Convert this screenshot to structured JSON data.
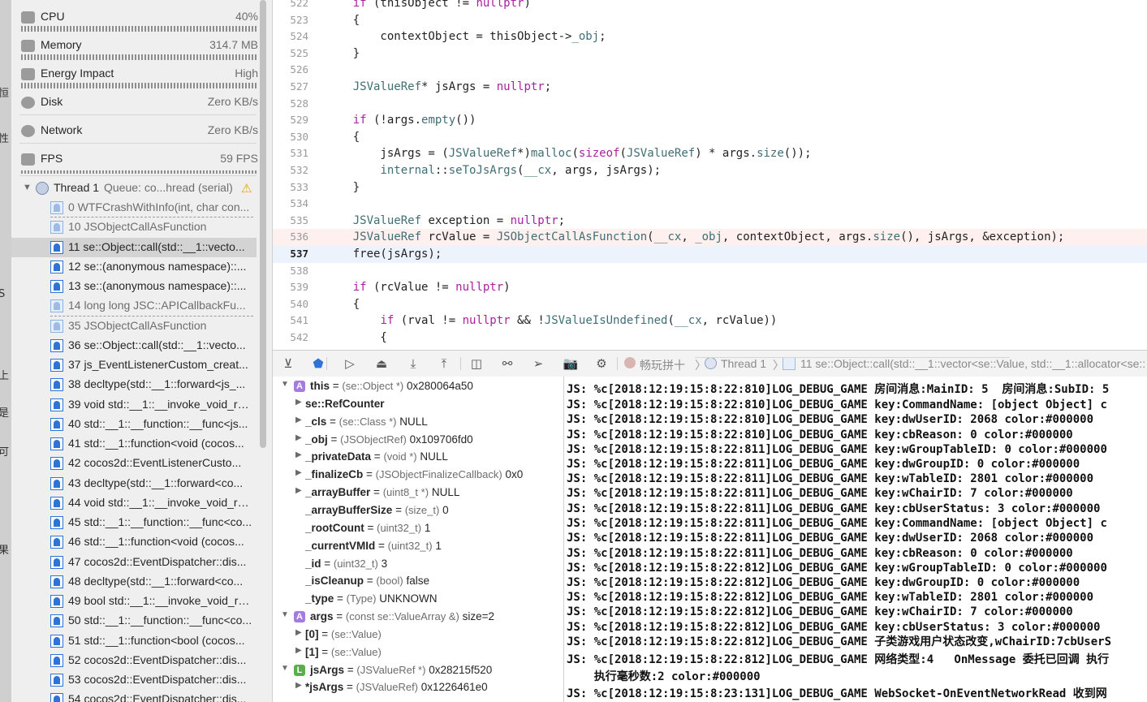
{
  "left_strip": [
    "恒",
    "性",
    "S",
    "上",
    "是",
    "可",
    "果"
  ],
  "gauges": [
    {
      "name": "CPU",
      "value": "40%",
      "icon": "cpu-icon"
    },
    {
      "name": "Memory",
      "value": "314.7 MB",
      "icon": "memory-icon"
    },
    {
      "name": "Energy Impact",
      "value": "High",
      "icon": "battery-icon"
    },
    {
      "name": "Disk",
      "value": "Zero KB/s",
      "icon": "disk-icon"
    },
    {
      "name": "Network",
      "value": "Zero KB/s",
      "icon": "network-icon"
    },
    {
      "name": "FPS",
      "value": "59 FPS",
      "icon": "fps-icon"
    }
  ],
  "thread": {
    "label": "Thread 1",
    "queue": "Queue: co...hread (serial)",
    "warning_icon": "warning-icon"
  },
  "frames": [
    {
      "text": "0 WTFCrashWithInfo(int, char con...",
      "system": true
    },
    {
      "text": "10 JSObjectCallAsFunction",
      "system": true
    },
    {
      "text": "11 se::Object::call(std::__1::vecto...",
      "system": false,
      "selected": true
    },
    {
      "text": "12 se::(anonymous namespace)::...",
      "system": false
    },
    {
      "text": "13 se::(anonymous namespace)::...",
      "system": false
    },
    {
      "text": "14 long long JSC::APICallbackFu...",
      "system": true
    },
    {
      "text": "35 JSObjectCallAsFunction",
      "system": true
    },
    {
      "text": "36 se::Object::call(std::__1::vecto...",
      "system": false
    },
    {
      "text": "37 js_EventListenerCustom_creat...",
      "system": false
    },
    {
      "text": "38 decltype(std::__1::forward<js_...",
      "system": false
    },
    {
      "text": "39 void std::__1::__invoke_void_re...",
      "system": false
    },
    {
      "text": "40 std::__1::__function::__func<js...",
      "system": false
    },
    {
      "text": "41 std::__1::function<void (cocos...",
      "system": false
    },
    {
      "text": "42 cocos2d::EventListenerCusto...",
      "system": false
    },
    {
      "text": "43 decltype(std::__1::forward<co...",
      "system": false
    },
    {
      "text": "44 void std::__1::__invoke_void_re...",
      "system": false
    },
    {
      "text": "45 std::__1::__function::__func<co...",
      "system": false
    },
    {
      "text": "46 std::__1::function<void (cocos...",
      "system": false
    },
    {
      "text": "47 cocos2d::EventDispatcher::dis...",
      "system": false
    },
    {
      "text": "48 decltype(std::__1::forward<co...",
      "system": false
    },
    {
      "text": "49 bool std::__1::__invoke_void_re...",
      "system": false
    },
    {
      "text": "50 std::__1::__function::__func<co...",
      "system": false
    },
    {
      "text": "51 std::__1::function<bool (cocos...",
      "system": false
    },
    {
      "text": "52 cocos2d::EventDispatcher::dis...",
      "system": false
    },
    {
      "text": "53 cocos2d::EventDispatcher::dis...",
      "system": false
    },
    {
      "text": "54 cocos2d::EventDispatcher::dis...",
      "system": false
    }
  ],
  "editor": {
    "current_line": 537,
    "highlight_line": 536,
    "lines": [
      {
        "no": "522",
        "code": "    if (thisObject != nullptr)"
      },
      {
        "no": "523",
        "code": "    {"
      },
      {
        "no": "524",
        "code": "        contextObject = thisObject->_obj;"
      },
      {
        "no": "525",
        "code": "    }"
      },
      {
        "no": "526",
        "code": ""
      },
      {
        "no": "527",
        "code": "    JSValueRef* jsArgs = nullptr;"
      },
      {
        "no": "528",
        "code": ""
      },
      {
        "no": "529",
        "code": "    if (!args.empty())"
      },
      {
        "no": "530",
        "code": "    {"
      },
      {
        "no": "531",
        "code": "        jsArgs = (JSValueRef*)malloc(sizeof(JSValueRef) * args.size());"
      },
      {
        "no": "532",
        "code": "        internal::seToJsArgs(__cx, args, jsArgs);"
      },
      {
        "no": "533",
        "code": "    }"
      },
      {
        "no": "534",
        "code": ""
      },
      {
        "no": "535",
        "code": "    JSValueRef exception = nullptr;"
      },
      {
        "no": "536",
        "code": "    JSValueRef rcValue = JSObjectCallAsFunction(__cx, _obj, contextObject, args.size(), jsArgs, &exception);"
      },
      {
        "no": "537",
        "code": "    free(jsArgs);"
      },
      {
        "no": "538",
        "code": ""
      },
      {
        "no": "539",
        "code": "    if (rcValue != nullptr)"
      },
      {
        "no": "540",
        "code": "    {"
      },
      {
        "no": "541",
        "code": "        if (rval != nullptr && !JSValueIsUndefined(__cx, rcValue))"
      },
      {
        "no": "542",
        "code": "        {"
      }
    ]
  },
  "debugbar": {
    "buttons": [
      {
        "name": "hide-debug-area-button",
        "icon": "panel-toggle-icon",
        "glyph": "⊻"
      },
      {
        "name": "breakpoints-toggle-button",
        "icon": "breakpoint-icon",
        "glyph": "⬟"
      },
      {
        "name": "continue-button",
        "icon": "continue-icon",
        "glyph": "▷"
      },
      {
        "name": "step-over-button",
        "icon": "step-over-icon",
        "glyph": "⏏"
      },
      {
        "name": "step-into-button",
        "icon": "step-into-icon",
        "glyph": "⤓"
      },
      {
        "name": "step-out-button",
        "icon": "step-out-icon",
        "glyph": "⤒"
      },
      {
        "name": "view-hierarchy-button",
        "icon": "view-hierarchy-icon",
        "glyph": "◫"
      },
      {
        "name": "memory-graph-button",
        "icon": "memory-graph-icon",
        "glyph": "⚯"
      },
      {
        "name": "simulate-location-button",
        "icon": "location-arrow-icon",
        "glyph": "➢"
      },
      {
        "name": "camera-button",
        "icon": "camera-icon",
        "glyph": "📷"
      },
      {
        "name": "environment-overrides-button",
        "icon": "gear-icon",
        "glyph": "⚙"
      }
    ],
    "breadcrumbs": [
      "畅玩拼十",
      "Thread 1",
      "11 se::Object::call(std::__1::vector<se::Value, std::__1::allocator<se::"
    ],
    "separator": "〉"
  },
  "variables": [
    {
      "indent": 0,
      "expand": "open",
      "badge": "A",
      "name": "this",
      "type": "(se::Object *)",
      "value": "0x280064a50"
    },
    {
      "indent": 1,
      "expand": "closed",
      "badge": "",
      "name": "se::RefCounter",
      "type": "",
      "value": ""
    },
    {
      "indent": 1,
      "expand": "closed",
      "badge": "",
      "name": "_cls",
      "type": "(se::Class *)",
      "value": "NULL"
    },
    {
      "indent": 1,
      "expand": "closed",
      "badge": "",
      "name": "_obj",
      "type": "(JSObjectRef)",
      "value": "0x109706fd0"
    },
    {
      "indent": 1,
      "expand": "closed",
      "badge": "",
      "name": "_privateData",
      "type": "(void *)",
      "value": "NULL"
    },
    {
      "indent": 1,
      "expand": "closed",
      "badge": "",
      "name": "_finalizeCb",
      "type": "(JSObjectFinalizeCallback)",
      "value": "0x0"
    },
    {
      "indent": 1,
      "expand": "closed",
      "badge": "",
      "name": "_arrayBuffer",
      "type": "(uint8_t *)",
      "value": "NULL"
    },
    {
      "indent": 1,
      "expand": "none",
      "badge": "",
      "name": "_arrayBufferSize",
      "type": "(size_t)",
      "value": "0"
    },
    {
      "indent": 1,
      "expand": "none",
      "badge": "",
      "name": "_rootCount",
      "type": "(uint32_t)",
      "value": "1"
    },
    {
      "indent": 1,
      "expand": "none",
      "badge": "",
      "name": "_currentVMId",
      "type": "(uint32_t)",
      "value": "1"
    },
    {
      "indent": 1,
      "expand": "none",
      "badge": "",
      "name": "_id",
      "type": "(uint32_t)",
      "value": "3"
    },
    {
      "indent": 1,
      "expand": "none",
      "badge": "",
      "name": "_isCleanup",
      "type": "(bool)",
      "value": "false"
    },
    {
      "indent": 1,
      "expand": "none",
      "badge": "",
      "name": "_type",
      "type": "(Type)",
      "value": "UNKNOWN"
    },
    {
      "indent": 0,
      "expand": "open",
      "badge": "A",
      "name": "args",
      "type": "(const se::ValueArray &)",
      "value": "size=2"
    },
    {
      "indent": 1,
      "expand": "closed",
      "badge": "",
      "name": "[0]",
      "type": "(se::Value)",
      "value": ""
    },
    {
      "indent": 1,
      "expand": "closed",
      "badge": "",
      "name": "[1]",
      "type": "(se::Value)",
      "value": ""
    },
    {
      "indent": 0,
      "expand": "open",
      "badge": "L",
      "name": "jsArgs",
      "type": "(JSValueRef *)",
      "value": "0x28215f520"
    },
    {
      "indent": 1,
      "expand": "closed",
      "badge": "",
      "name": "*jsArgs",
      "type": "(JSValueRef)",
      "value": "0x1226461e0"
    }
  ],
  "console": [
    "JS: %c[2018:12:19:15:8:22:810]LOG_DEBUG_GAME 房间消息:MainID: 5  房间消息:SubID: 5",
    "JS: %c[2018:12:19:15:8:22:810]LOG_DEBUG_GAME key:CommandName: [object Object] c",
    "JS: %c[2018:12:19:15:8:22:810]LOG_DEBUG_GAME key:dwUserID: 2068 color:#000000",
    "JS: %c[2018:12:19:15:8:22:810]LOG_DEBUG_GAME key:cbReason: 0 color:#000000",
    "JS: %c[2018:12:19:15:8:22:811]LOG_DEBUG_GAME key:wGroupTableID: 0 color:#000000",
    "JS: %c[2018:12:19:15:8:22:811]LOG_DEBUG_GAME key:dwGroupID: 0 color:#000000",
    "JS: %c[2018:12:19:15:8:22:811]LOG_DEBUG_GAME key:wTableID: 2801 color:#000000",
    "JS: %c[2018:12:19:15:8:22:811]LOG_DEBUG_GAME key:wChairID: 7 color:#000000",
    "JS: %c[2018:12:19:15:8:22:811]LOG_DEBUG_GAME key:cbUserStatus: 3 color:#000000",
    "JS: %c[2018:12:19:15:8:22:811]LOG_DEBUG_GAME key:CommandName: [object Object] c",
    "JS: %c[2018:12:19:15:8:22:811]LOG_DEBUG_GAME key:dwUserID: 2068 color:#000000",
    "JS: %c[2018:12:19:15:8:22:811]LOG_DEBUG_GAME key:cbReason: 0 color:#000000",
    "JS: %c[2018:12:19:15:8:22:812]LOG_DEBUG_GAME key:wGroupTableID: 0 color:#000000",
    "JS: %c[2018:12:19:15:8:22:812]LOG_DEBUG_GAME key:dwGroupID: 0 color:#000000",
    "JS: %c[2018:12:19:15:8:22:812]LOG_DEBUG_GAME key:wTableID: 2801 color:#000000",
    "JS: %c[2018:12:19:15:8:22:812]LOG_DEBUG_GAME key:wChairID: 7 color:#000000",
    "JS: %c[2018:12:19:15:8:22:812]LOG_DEBUG_GAME key:cbUserStatus: 3 color:#000000",
    "JS: %c[2018:12:19:15:8:22:812]LOG_DEBUG_GAME 子类游戏用户状态改变,wChairID:7cbUserS",
    "JS: %c[2018:12:19:15:8:22:812]LOG_DEBUG_GAME 网络类型:4   OnMessage 委托已回调 执行",
    "    执行毫秒数:2 color:#000000",
    "JS: %c[2018:12:19:15:8:23:131]LOG_DEBUG_GAME WebSocket-OnEventNetworkRead 收到网"
  ],
  "colors": {
    "accent": "#2f73d6",
    "keyword": "#a9219f",
    "type": "#3f6e74",
    "highlight_line": "#fdf0ee",
    "current_line": "#edf3fd",
    "warning": "#e5a300"
  }
}
